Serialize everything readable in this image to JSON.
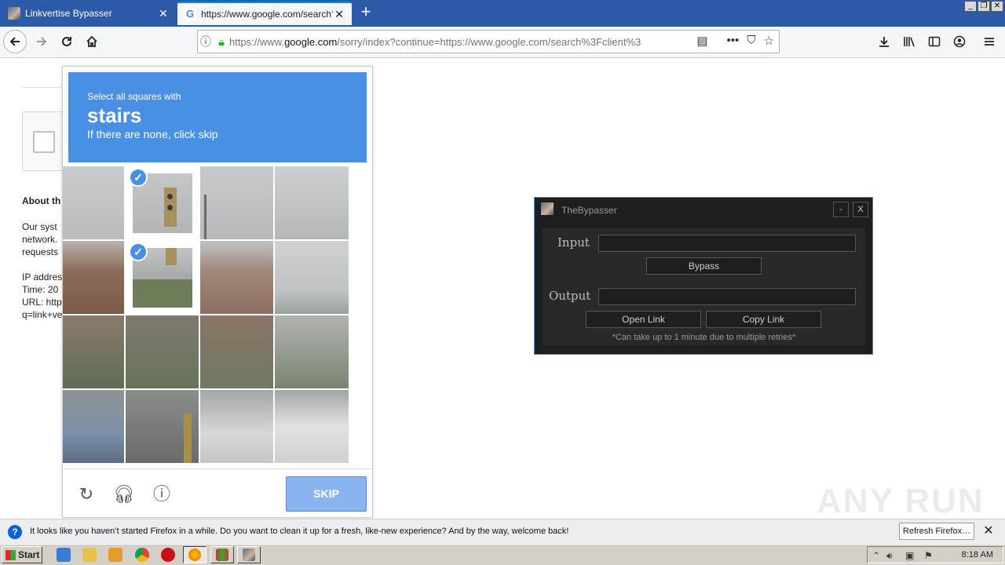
{
  "browser": {
    "tabs": [
      {
        "label": "Linkvertise Bypasser"
      },
      {
        "label": "https://www.google.com/search?c"
      }
    ],
    "url_prefix": "https://www.",
    "url_host": "google.com",
    "url_rest": "/sorry/index?continue=https://www.google.com/search%3Fclient%3"
  },
  "page": {
    "about_heading": "About th",
    "lines": [
      "Our syst",
      "network.",
      "requests",
      "IP addres",
      "Time: 20",
      "URL: http",
      "q=link+ve"
    ]
  },
  "captcha": {
    "instruction_small": "Select all squares with",
    "instruction_big": "stairs",
    "instruction_sub": "If there are none, click skip",
    "skip_label": "SKIP"
  },
  "bypasser": {
    "title": "TheBypasser",
    "minimize": "-",
    "close": "X",
    "input_label": "Input",
    "bypass_button": "Bypass",
    "output_label": "Output",
    "open_link_button": "Open Link",
    "copy_link_button": "Copy Link",
    "note": "*Can take up to 1 minute due to multiple retries*"
  },
  "watermark": "ANY RUN",
  "notification": {
    "text": "It looks like you haven’t started Firefox in a while. Do you want to clean it up for a fresh, like-new experience? And by the way, welcome back!",
    "button": "Refresh Firefox…"
  },
  "taskbar": {
    "start_label": "Start",
    "clock": "8:18 AM"
  }
}
